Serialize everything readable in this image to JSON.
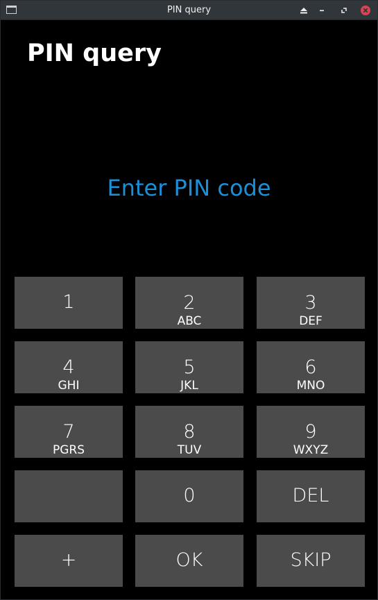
{
  "window": {
    "title": "PIN query",
    "icons": {
      "app": "window-icon",
      "keep_above": "eject-icon",
      "minimize": "minimize-icon",
      "maximize": "restore-icon",
      "close": "close-icon"
    },
    "colors": {
      "titlebar": "#31363b",
      "close": "#da4453"
    }
  },
  "screen": {
    "heading": "PIN query",
    "prompt": "Enter PIN code",
    "colors": {
      "background": "#000000",
      "prompt": "#1b8fd8",
      "key": "#4b4b4b",
      "text": "#ffffff"
    }
  },
  "keypad": {
    "k1": {
      "main": "1",
      "sub": ""
    },
    "k2": {
      "main": "2",
      "sub": "ABC"
    },
    "k3": {
      "main": "3",
      "sub": "DEF"
    },
    "k4": {
      "main": "4",
      "sub": "GHI"
    },
    "k5": {
      "main": "5",
      "sub": "JKL"
    },
    "k6": {
      "main": "6",
      "sub": "MNO"
    },
    "k7": {
      "main": "7",
      "sub": "PGRS"
    },
    "k8": {
      "main": "8",
      "sub": "TUV"
    },
    "k9": {
      "main": "9",
      "sub": "WXYZ"
    },
    "blank": {
      "main": ""
    },
    "k0": {
      "main": "0"
    },
    "del": {
      "main": "DEL"
    },
    "plus": {
      "main": "+"
    },
    "ok": {
      "main": "OK"
    },
    "skip": {
      "main": "SKIP"
    }
  }
}
